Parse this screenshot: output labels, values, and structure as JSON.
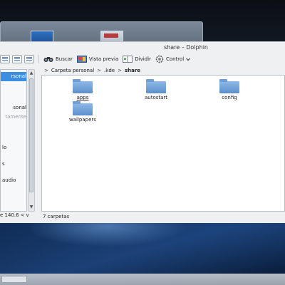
{
  "window": {
    "title": "share – Dolphin"
  },
  "toolbar": {
    "search_label": "Buscar",
    "preview_label": "Vista previa",
    "split_label": "Dividir",
    "control_label": "Control"
  },
  "breadcrumb": {
    "items": [
      "Carpeta personal",
      ".kde",
      "share"
    ]
  },
  "sidebar": {
    "items": [
      {
        "label": "rsonal"
      },
      {
        "label": "sonal"
      },
      {
        "label": "tamente"
      },
      {
        "label": "lo"
      },
      {
        "label": "s"
      },
      {
        "label": "audio"
      }
    ],
    "free_space": "e 140.6"
  },
  "content": {
    "folders": [
      {
        "label": "apps"
      },
      {
        "label": "autostart"
      },
      {
        "label": "config"
      },
      {
        "label": "wallpapers"
      }
    ]
  },
  "status": {
    "text": "7 carpetas"
  },
  "icons": {
    "search": "binoculars-icon",
    "preview": "preview-icon",
    "split": "split-icon",
    "control": "gear-icon"
  }
}
